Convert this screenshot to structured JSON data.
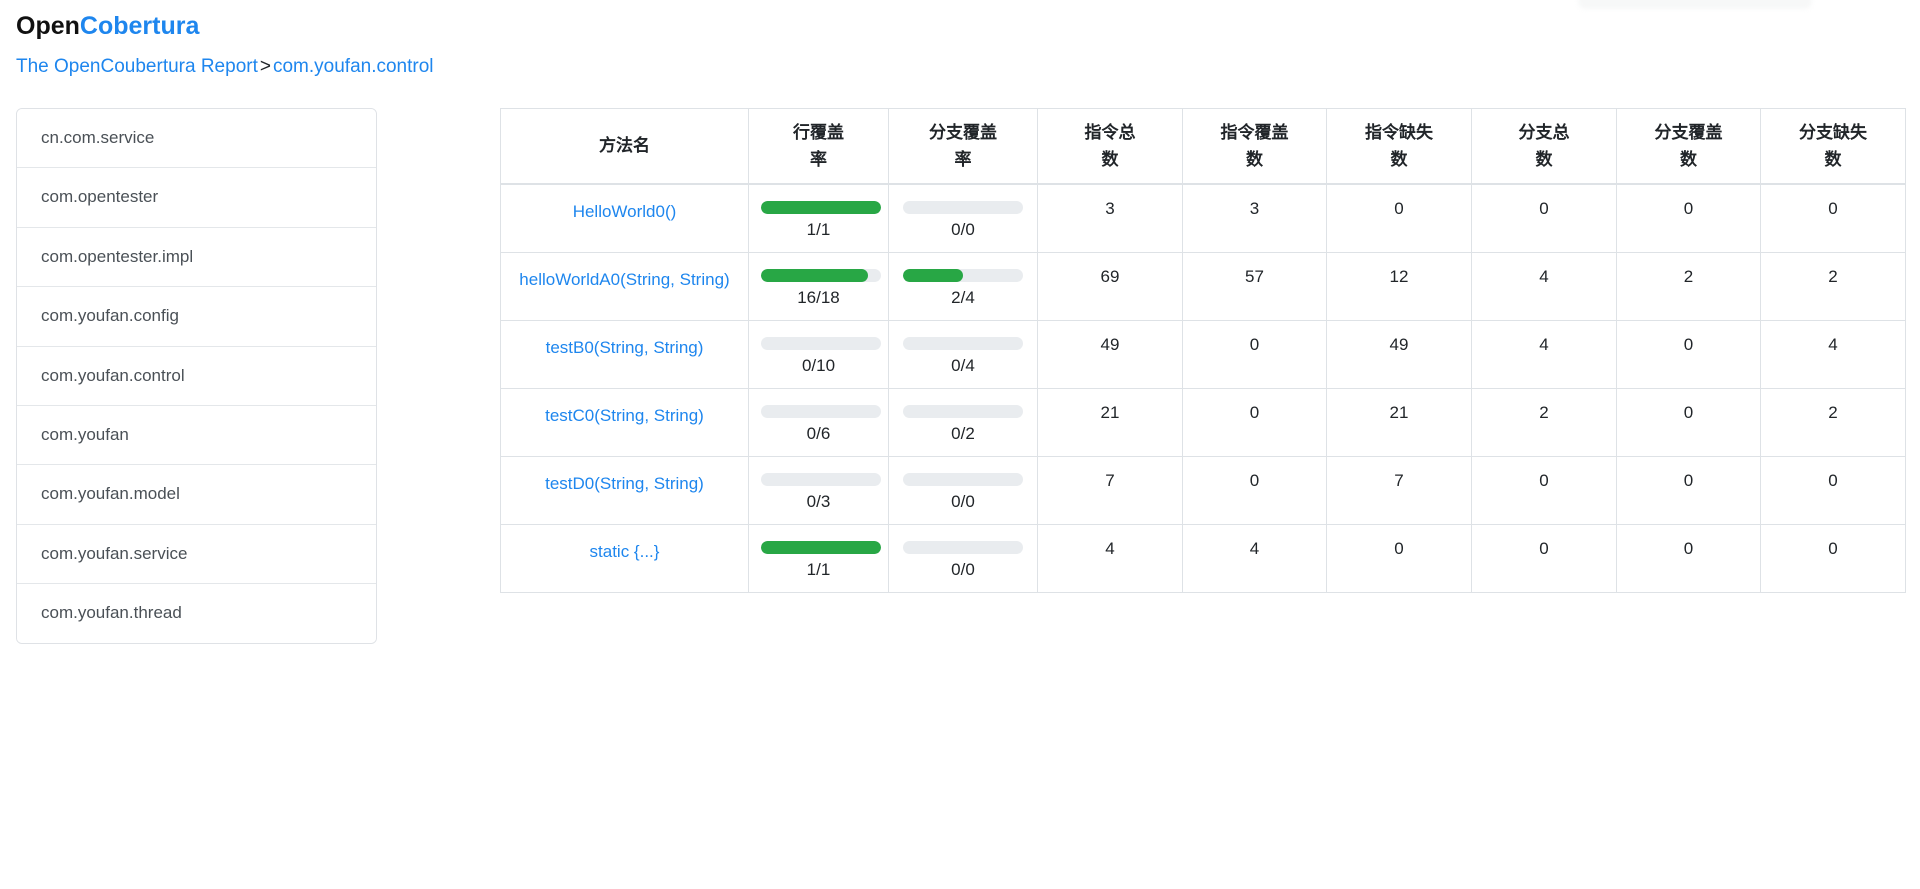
{
  "brand": {
    "prefix": "Open",
    "suffix": "Cobertura"
  },
  "breadcrumb": {
    "report_link": "The OpenCoubertura Report",
    "separator": ">",
    "current": "com.youfan.control"
  },
  "sidebar": {
    "items": [
      {
        "label": "cn.com.service"
      },
      {
        "label": "com.opentester"
      },
      {
        "label": "com.opentester.impl"
      },
      {
        "label": "com.youfan.config"
      },
      {
        "label": "com.youfan.control"
      },
      {
        "label": "com.youfan"
      },
      {
        "label": "com.youfan.model"
      },
      {
        "label": "com.youfan.service"
      },
      {
        "label": "com.youfan.thread"
      }
    ]
  },
  "table": {
    "headers": [
      "方法名",
      "行覆盖\n率",
      "分支覆盖\n率",
      "指令总\n数",
      "指令覆盖\n数",
      "指令缺失\n数",
      "分支总\n数",
      "分支覆盖\n数",
      "分支缺失\n数"
    ],
    "rows": [
      {
        "method": "HelloWorld0()",
        "line_cov": {
          "fraction": "1/1",
          "pct": 100
        },
        "branch_cov": {
          "fraction": "0/0",
          "pct": 0
        },
        "inst_total": "3",
        "inst_covered": "3",
        "inst_missed": "0",
        "branch_total": "0",
        "branch_covered": "0",
        "branch_missed": "0"
      },
      {
        "method": "helloWorldA0(String, String)",
        "line_cov": {
          "fraction": "16/18",
          "pct": 89
        },
        "branch_cov": {
          "fraction": "2/4",
          "pct": 50
        },
        "inst_total": "69",
        "inst_covered": "57",
        "inst_missed": "12",
        "branch_total": "4",
        "branch_covered": "2",
        "branch_missed": "2"
      },
      {
        "method": "testB0(String, String)",
        "line_cov": {
          "fraction": "0/10",
          "pct": 0
        },
        "branch_cov": {
          "fraction": "0/4",
          "pct": 0
        },
        "inst_total": "49",
        "inst_covered": "0",
        "inst_missed": "49",
        "branch_total": "4",
        "branch_covered": "0",
        "branch_missed": "4"
      },
      {
        "method": "testC0(String, String)",
        "line_cov": {
          "fraction": "0/6",
          "pct": 0
        },
        "branch_cov": {
          "fraction": "0/2",
          "pct": 0
        },
        "inst_total": "21",
        "inst_covered": "0",
        "inst_missed": "21",
        "branch_total": "2",
        "branch_covered": "0",
        "branch_missed": "2"
      },
      {
        "method": "testD0(String, String)",
        "line_cov": {
          "fraction": "0/3",
          "pct": 0
        },
        "branch_cov": {
          "fraction": "0/0",
          "pct": 0
        },
        "inst_total": "7",
        "inst_covered": "0",
        "inst_missed": "7",
        "branch_total": "0",
        "branch_covered": "0",
        "branch_missed": "0"
      },
      {
        "method": "static {...}",
        "line_cov": {
          "fraction": "1/1",
          "pct": 100
        },
        "branch_cov": {
          "fraction": "0/0",
          "pct": 0
        },
        "inst_total": "4",
        "inst_covered": "4",
        "inst_missed": "0",
        "branch_total": "0",
        "branch_covered": "0",
        "branch_missed": "0"
      }
    ]
  },
  "colors": {
    "link_blue": "#1e86ee",
    "bar_green": "#28a745",
    "bar_background": "#e9ecef",
    "table_border": "#dee2e6"
  }
}
